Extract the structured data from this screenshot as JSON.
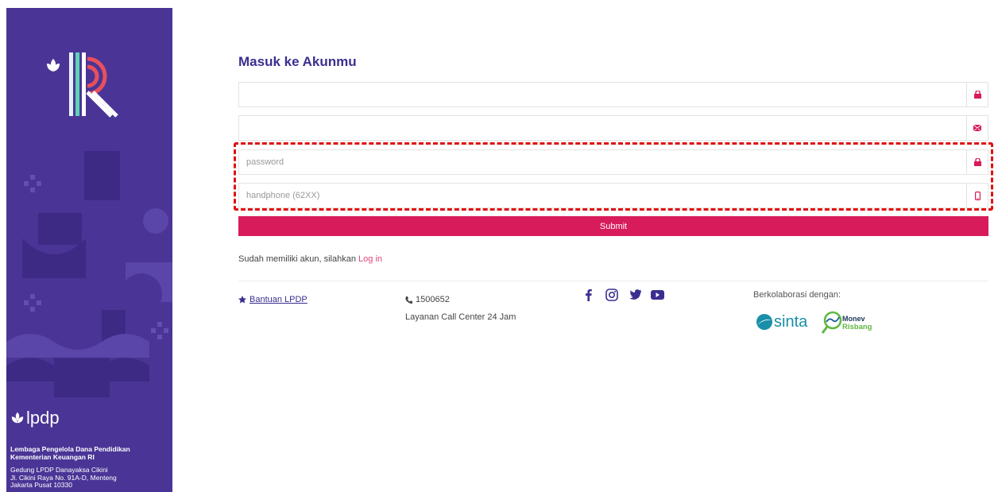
{
  "sidebar": {
    "brand": "lpdp",
    "org_line1": "Lembaga Pengelola Dana Pendidikan",
    "org_line2": "Kementerian Keuangan RI",
    "addr_line1": "Gedung LPDP Danayaksa Cikini",
    "addr_line2": "Jl. Cikini Raya No. 91A-D, Menteng",
    "addr_line3": "Jakarta Pusat 10330"
  },
  "form": {
    "title": "Masuk ke Akunmu",
    "field1": {
      "value": "",
      "placeholder": ""
    },
    "field2": {
      "value": "",
      "placeholder": ""
    },
    "password": {
      "value": "",
      "placeholder": "password"
    },
    "handphone": {
      "value": "",
      "placeholder": "handphone (62XX)"
    },
    "submit_label": "Submit",
    "login_prompt": "Sudah memiliki akun, silahkan",
    "login_link": "Log in"
  },
  "footer": {
    "help_label": "Bantuan LPDP",
    "phone": "1500652",
    "call_center": "Layanan Call Center 24 Jam",
    "collab_label": "Berkolaborasi dengan:",
    "partner1": "sinta",
    "partner2_line1": "Monev",
    "partner2_line2": "Risbang"
  },
  "colors": {
    "sidebar": "#4a3596",
    "accent": "#d81b5a",
    "title": "#3a2f8f",
    "annotation": "#e01010"
  }
}
